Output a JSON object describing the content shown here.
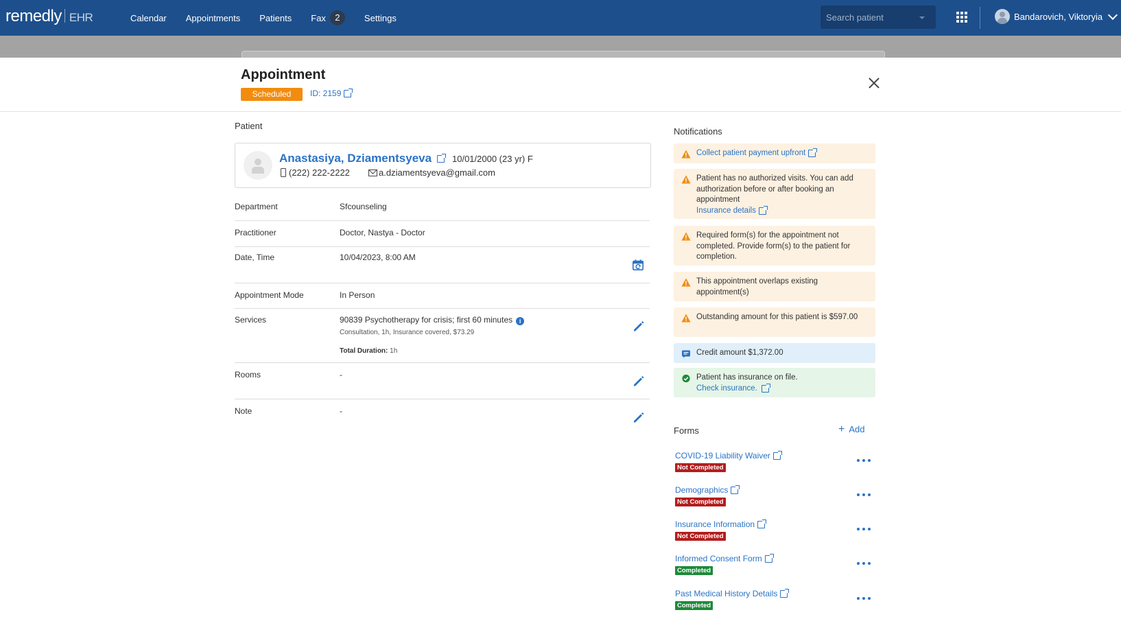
{
  "topbar": {
    "logo_main": "remedly",
    "logo_sub": "EHR",
    "nav": [
      {
        "label": "Calendar"
      },
      {
        "label": "Appointments"
      },
      {
        "label": "Patients"
      },
      {
        "label": "Fax",
        "badge": "2"
      },
      {
        "label": "Settings"
      }
    ],
    "search_placeholder": "Search patient",
    "user_name": "Bandarovich, Viktoryia"
  },
  "modal": {
    "title": "Appointment",
    "status": "Scheduled",
    "id_label": "ID: 2159"
  },
  "patient": {
    "section_label": "Patient",
    "name": "Anastasiya, Dziamentsyeva",
    "dob": "10/01/2000 (23 yr) F",
    "phone": "(222) 222-2222",
    "email": "a.dziamentsyeva@gmail.com"
  },
  "details": {
    "department_label": "Department",
    "department": "Sfcounseling",
    "practitioner_label": "Practitioner",
    "practitioner": "Doctor, Nastya - Doctor",
    "datetime_label": "Date, Time",
    "datetime": "10/04/2023, 8:00 AM",
    "mode_label": "Appointment Mode",
    "mode": "In Person",
    "services_label": "Services",
    "service_name": "90839 Psychotherapy for crisis; first 60 minutes",
    "service_detail": "Consultation, 1h, Insurance covered, $73.29",
    "total_duration_label": "Total Duration:",
    "total_duration": "1h",
    "rooms_label": "Rooms",
    "rooms": "-",
    "note_label": "Note",
    "note": "-"
  },
  "notifications": {
    "title": "Notifications",
    "items": [
      {
        "type": "warn",
        "text": "",
        "link": "Collect patient payment upfront"
      },
      {
        "type": "warn",
        "text": "Patient has no authorized visits. You can add authorization before or after booking an appointment",
        "link": "Insurance details"
      },
      {
        "type": "warn",
        "text": "Required form(s) for the appointment not completed. Provide form(s) to the patient for completion.",
        "link": ""
      },
      {
        "type": "warn",
        "text": "This appointment overlaps existing appointment(s)",
        "link": ""
      },
      {
        "type": "warn",
        "text": "Outstanding amount for this patient is $597.00",
        "link": ""
      },
      {
        "type": "info",
        "text": "Credit amount $1,372.00",
        "link": ""
      },
      {
        "type": "ok",
        "text": "Patient has insurance on file.",
        "link": "Check insurance."
      }
    ]
  },
  "forms": {
    "title": "Forms",
    "add_label": "Add",
    "items": [
      {
        "name": "COVID-19 Liability Waiver",
        "status": "Not Completed"
      },
      {
        "name": "Demographics",
        "status": "Not Completed"
      },
      {
        "name": "Insurance Information",
        "status": "Not Completed"
      },
      {
        "name": "Informed Consent Form",
        "status": "Completed"
      },
      {
        "name": "Past Medical History Details",
        "status": "Completed"
      }
    ]
  },
  "colors": {
    "topbar": "#1d4f8c",
    "link": "#2a73c5",
    "scheduled": "#f28c0f",
    "not_completed": "#b41d1d",
    "completed": "#1e8a3a",
    "warn_bg": "#fdf1e1",
    "info_bg": "#e0eff9",
    "ok_bg": "#e5f5e7"
  },
  "icons": {
    "close": "close-icon",
    "external": "external-link-icon",
    "edit": "pencil-icon",
    "reschedule": "calendar-refresh-icon",
    "warning": "warning-triangle-icon",
    "credit": "message-icon",
    "check": "check-circle-icon",
    "more": "more-dots-icon"
  }
}
